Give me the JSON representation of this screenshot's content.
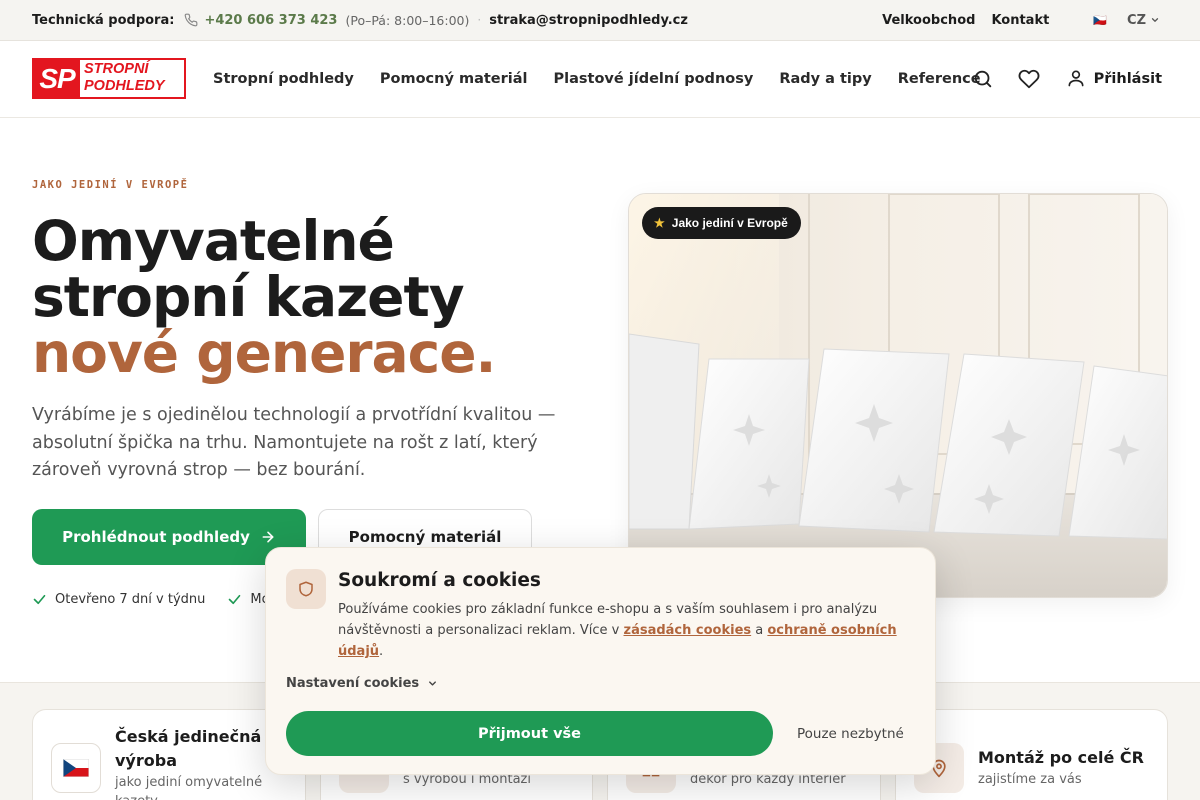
{
  "topbar": {
    "support_label": "Technická podpora:",
    "phone": "+420 606 373 423",
    "hours": "(Po–Pá: 8:00–16:00)",
    "separator": "·",
    "email": "straka@stropnipodhledy.cz",
    "links": [
      "Velkoobchod",
      "Kontakt"
    ],
    "lang_flag": "🇨🇿",
    "lang": "CZ"
  },
  "header": {
    "logo": {
      "mark": "SP",
      "line1": "STROPNÍ",
      "line2": "PODHLEDY"
    },
    "nav": [
      "Stropní podhledy",
      "Pomocný materiál",
      "Plastové jídelní podnosy",
      "Rady a tipy",
      "Reference"
    ],
    "login": "Přihlásit",
    "icons": [
      "search-icon",
      "heart-icon",
      "user-icon"
    ]
  },
  "hero": {
    "eyebrow": "JAKO JEDINÍ V EVROPĚ",
    "title_line1": "Omyvatelné",
    "title_line2": "stropní kazety",
    "title_accent": "nové generace.",
    "lead": "Vyrábíme je s ojedinělou technologií a prvotřídní kvalitou — absolutní špička na trhu. Namontujete na rošt z latí, který zároveň vyrovná strop — bez bourání.",
    "cta_primary": "Prohlédnout podhledy",
    "cta_secondary": "Pomocný materiál",
    "checks": [
      "Otevřeno 7 dní v týdnu",
      "Mont"
    ],
    "badge": "Jako jediní v Evropě"
  },
  "features": [
    {
      "title_line1": "Česká jedinečná",
      "title_line2": "výroba",
      "sub_line1": "jako jediní omyvatelné",
      "sub_line2": "kazety",
      "icon": "czech-flag-icon"
    },
    {
      "title": "",
      "sub": "s výrobou i montáží",
      "icon": "wrench-icon"
    },
    {
      "title": "",
      "sub": "dekor pro každý interiér",
      "icon": "grid-icon"
    },
    {
      "title": "Montáž po celé ČR",
      "sub": "zajistíme za vás",
      "icon": "map-pin-icon"
    }
  ],
  "cookie": {
    "title": "Soukromí a cookies",
    "text_before": "Používáme cookies pro základní funkce e-shopu a s vaším souhlasem i pro analýzu návštěvnosti a personalizaci reklam. Více v ",
    "link1": "zásadách cookies",
    "text_mid": " a ",
    "link2": "ochraně osobních údajů",
    "text_after": ".",
    "settings": "Nastavení cookies",
    "accept": "Přijmout vše",
    "necessary": "Pouze nezbytné"
  },
  "colors": {
    "accent": "#b0653c",
    "primary_green": "#1f9a55",
    "logo_red": "#e3161f"
  }
}
